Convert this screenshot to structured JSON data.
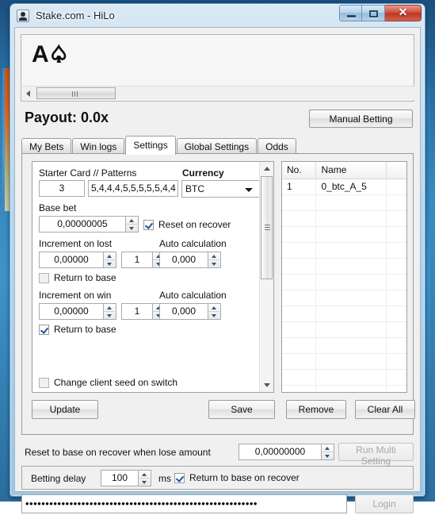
{
  "window": {
    "title": "Stake.com - HiLo",
    "icon": "app-icon",
    "minimize_label": "",
    "maximize_label": "",
    "close_label": "✕"
  },
  "card": {
    "rank": "A",
    "suit": "♤"
  },
  "payout": {
    "text": "Payout: 0.0x"
  },
  "manual_betting": {
    "label": "Manual Betting"
  },
  "tabs": [
    {
      "label": "My Bets",
      "active": false
    },
    {
      "label": "Win logs",
      "active": false
    },
    {
      "label": "Settings",
      "active": true
    },
    {
      "label": "Global Settings",
      "active": false
    },
    {
      "label": "Odds",
      "active": false
    }
  ],
  "settings": {
    "starter_card_label": "Starter Card  //  Patterns",
    "starter_card_value": "3",
    "patterns_value": "5,4,4,4,5,5,5,5,5,4,4",
    "currency_label": "Currency",
    "currency_value": "BTC",
    "base_bet_label": "Base bet",
    "base_bet_value": "0,00000005",
    "reset_on_recover_label": "Reset on recover",
    "increment_on_lost_label": "Increment on lost",
    "increment_on_lost_amount": "0,00000",
    "increment_on_lost_multiplier": "1",
    "auto_calculation_label": "Auto calculation",
    "auto_calculation_lost_value": "0,000",
    "return_to_base_lost_label": "Return to base",
    "increment_on_win_label": "Increment on win",
    "increment_on_win_amount": "0,00000",
    "increment_on_win_multiplier": "1",
    "auto_calculation_win_label": "Auto calculation",
    "auto_calculation_win_value": "0,000",
    "return_to_base_win_label": "Return to base",
    "change_client_seed_label": "Change client seed on switch"
  },
  "list": {
    "columns": [
      "No.",
      "Name",
      ""
    ],
    "rows": [
      {
        "no": "1",
        "name": "0_btc_A_5"
      }
    ],
    "empty_rows": 13
  },
  "buttons": {
    "update": "Update",
    "save": "Save",
    "remove": "Remove",
    "clear_all": "Clear All",
    "run_multi_setting": "Run Multi Setting",
    "login": "Login"
  },
  "reset_row": {
    "label": "Reset to base on recover when lose amount",
    "value": "0,00000000"
  },
  "delay_row": {
    "label": "Betting delay",
    "value": "100",
    "unit": "ms",
    "return_to_base_label": "Return to base on recover"
  },
  "login_row": {
    "password_masked": "••••••••••••••••••••••••••••••••••••••••••••••••••••••••••"
  }
}
